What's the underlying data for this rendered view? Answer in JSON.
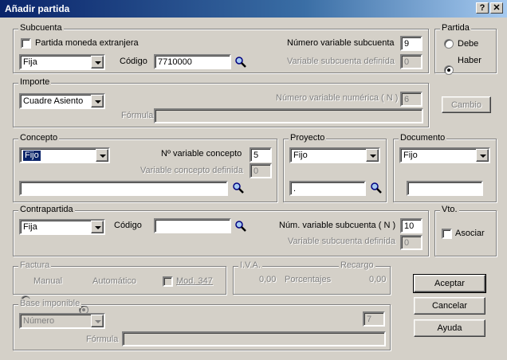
{
  "window": {
    "title": "Añadir partida",
    "help_btn": "?",
    "close_btn": "✕"
  },
  "subcuenta": {
    "legend": "Subcuenta",
    "moneda_extranjera": "Partida moneda extranjera",
    "tipo": "Fija",
    "codigo_label": "Código",
    "codigo": "7710000",
    "num_var_label": "Número variable subcuenta",
    "num_var": "9",
    "var_def_label": "Variable subcuenta definida",
    "var_def": "0"
  },
  "partida": {
    "legend": "Partida",
    "debe": "Debe",
    "haber": "Haber",
    "selected": "haber"
  },
  "importe": {
    "legend": "Importe",
    "tipo": "Cuadre Asiento",
    "num_var_label": "Número variable numérica ( N )",
    "num_var": "6",
    "formula_label": "Fórmula",
    "formula": "",
    "cambio": "Cambio"
  },
  "concepto": {
    "legend": "Concepto",
    "tipo": "Fijo",
    "num_var_label": "Nº variable concepto",
    "num_var": "5",
    "var_def_label": "Variable concepto definida",
    "var_def": "0",
    "texto": ""
  },
  "proyecto": {
    "legend": "Proyecto",
    "tipo": "Fijo",
    "valor": "."
  },
  "documento": {
    "legend": "Documento",
    "tipo": "Fijo",
    "valor": ""
  },
  "contrapartida": {
    "legend": "Contrapartida",
    "tipo": "Fija",
    "codigo_label": "Código",
    "codigo": "",
    "num_var_label": "Núm. variable subcuenta ( N )",
    "num_var": "10",
    "var_def_label": "Variable subcuenta definida",
    "var_def": "0"
  },
  "vto": {
    "legend": "Vto.",
    "asociar": "Asociar"
  },
  "factura": {
    "legend": "Factura",
    "manual": "Manual",
    "automatico": "Automático",
    "mod347": "Mod. 347"
  },
  "iva": {
    "legend": "I.V.A.",
    "recargo": "Recargo",
    "iva_val": "0,00",
    "porcentajes": "Porcentajes",
    "recargo_val": "0,00"
  },
  "base": {
    "legend": "Base imponible",
    "tipo": "Número",
    "num": "7",
    "formula_label": "Fórmula",
    "formula": ""
  },
  "buttons": {
    "aceptar": "Aceptar",
    "cancelar": "Cancelar",
    "ayuda": "Ayuda"
  }
}
